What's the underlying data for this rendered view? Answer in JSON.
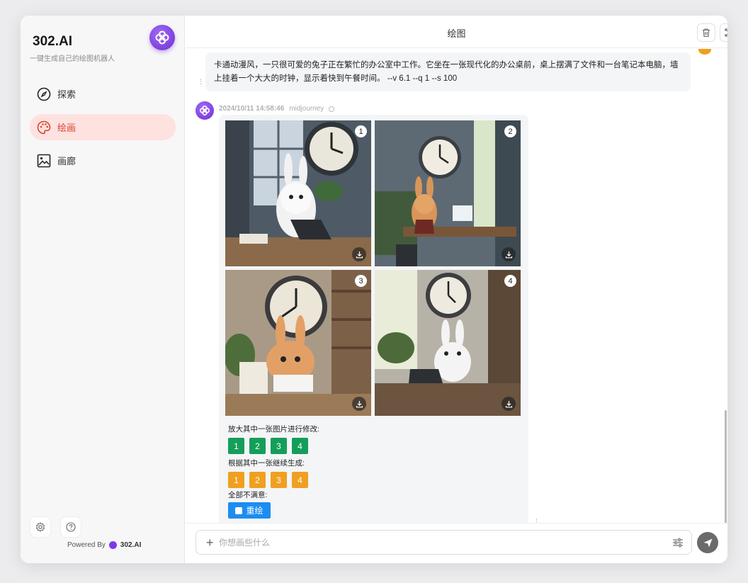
{
  "app": {
    "brand": "302.AI",
    "tagline": "一键生成自己的绘图机器人",
    "powered_by": "Powered By",
    "powered_brand": "302.AI"
  },
  "sidebar": {
    "items": [
      {
        "label": "探索",
        "icon": "compass-icon",
        "active": false
      },
      {
        "label": "绘画",
        "icon": "palette-icon",
        "active": true
      },
      {
        "label": "画廊",
        "icon": "image-icon",
        "active": false
      }
    ],
    "bottom_icons": [
      "settings-icon",
      "help-icon"
    ]
  },
  "header": {
    "title": "绘图",
    "actions": [
      "trash-icon",
      "expand-icon"
    ]
  },
  "chat": {
    "prompt": "卡通动漫风，一只很可爱的兔子正在繁忙的办公室中工作。它坐在一张现代化的办公桌前，桌上摆满了文件和一台笔记本电脑，墙上挂着一个大大的时钟，显示着快到午餐时间。 --v 6.1  --q 1  --s 100",
    "reply": {
      "timestamp": "2024/10/11 14:58:46",
      "model": "midjourney",
      "images": [
        {
          "index": "1",
          "rabbit": "white"
        },
        {
          "index": "2",
          "rabbit": "tan"
        },
        {
          "index": "3",
          "rabbit": "tan"
        },
        {
          "index": "4",
          "rabbit": "white"
        }
      ],
      "upscale_label": "放大其中一张图片进行修改:",
      "upscale_buttons": [
        "1",
        "2",
        "3",
        "4"
      ],
      "variation_label": "根据其中一张继续生成:",
      "variation_buttons": [
        "1",
        "2",
        "3",
        "4"
      ],
      "reroll_label": "全部不满意:",
      "reroll_button": "重绘"
    }
  },
  "composer": {
    "placeholder": "你想画些什么"
  },
  "colors": {
    "accent_purple": "#7a3ce8",
    "active_nav_bg": "#fde2e0",
    "active_nav_text": "#d9452e",
    "upscale_green": "#159e5a",
    "variation_orange": "#f0a020",
    "reroll_blue": "#1c8df0"
  }
}
